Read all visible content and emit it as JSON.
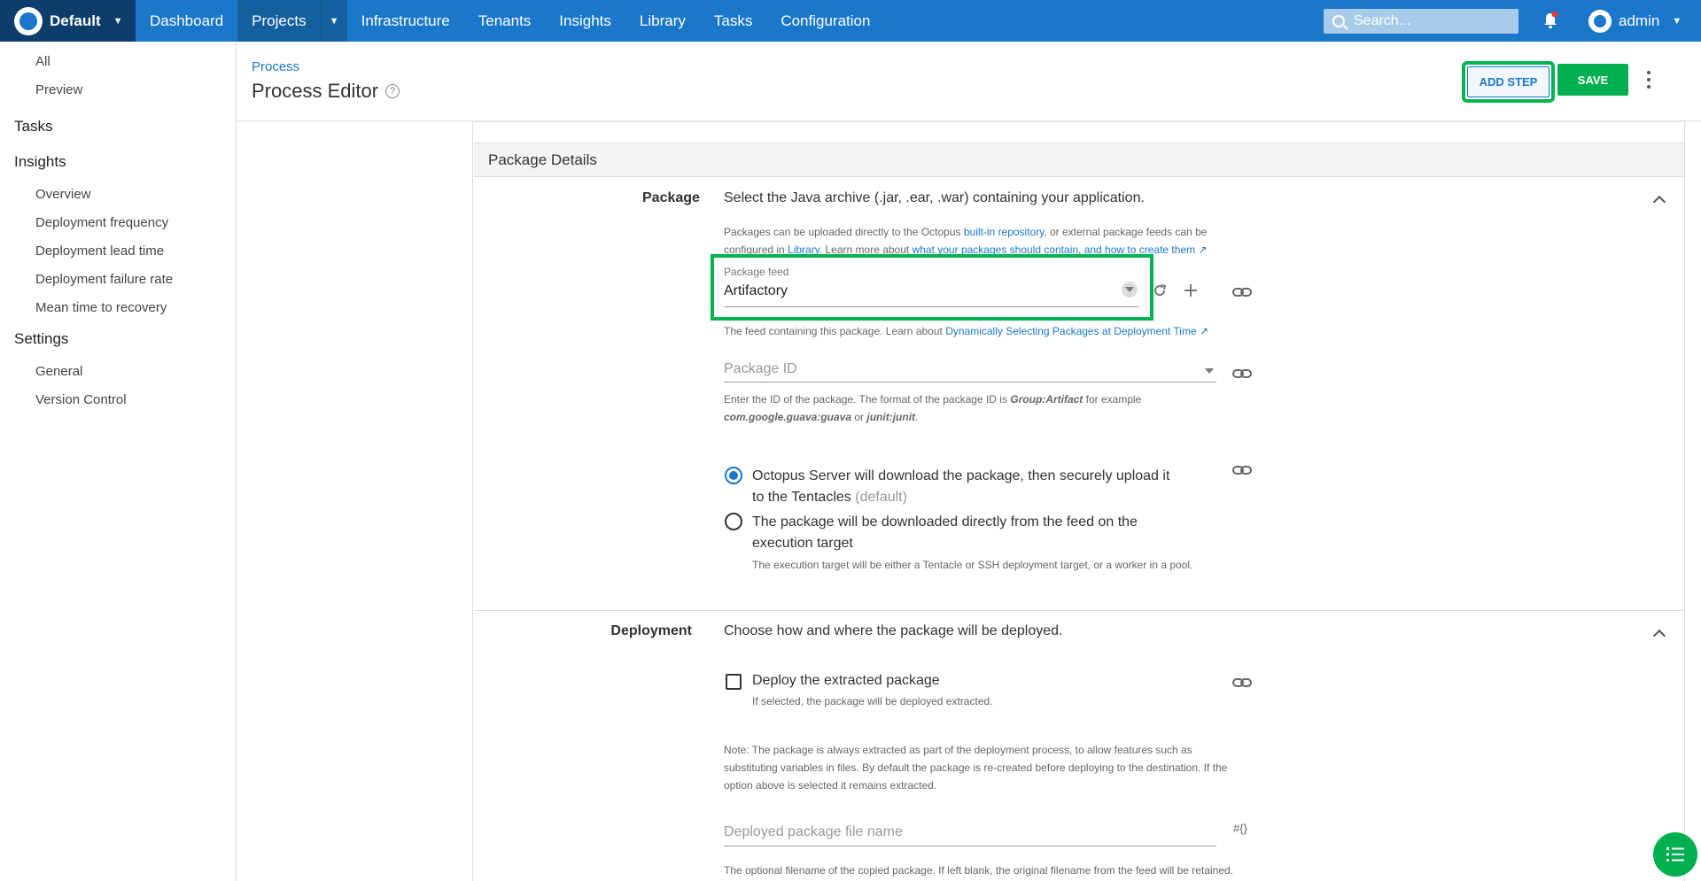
{
  "topnav": {
    "space_name": "Default",
    "items": [
      "Dashboard",
      "Projects",
      "Infrastructure",
      "Tenants",
      "Insights",
      "Library",
      "Tasks",
      "Configuration"
    ],
    "search_placeholder": "Search...",
    "user": "admin"
  },
  "sidebar": {
    "items_top": [
      "All",
      "Preview"
    ],
    "tasks": "Tasks",
    "insights": "Insights",
    "insights_items": [
      "Overview",
      "Deployment frequency",
      "Deployment lead time",
      "Deployment failure rate",
      "Mean time to recovery"
    ],
    "settings": "Settings",
    "settings_items": [
      "General",
      "Version Control"
    ]
  },
  "header": {
    "breadcrumb": "Process",
    "title": "Process Editor",
    "add_step": "ADD STEP",
    "save": "SAVE"
  },
  "section": {
    "title": "Package Details",
    "package_label": "Package",
    "package_desc": "Select the Java archive (.jar, .ear, .war) containing your application.",
    "pkg_help_1a": "Packages can be uploaded directly to the Octopus ",
    "pkg_help_1_link": "built-in repository",
    "pkg_help_1b": ", or external package feeds can be",
    "pkg_help_2a": "configured in ",
    "pkg_help_2_link1": "Library",
    "pkg_help_2b": ". Learn more about ",
    "pkg_help_2_link2": "what your packages should contain, and how to create them",
    "feed_label": "Package feed",
    "feed_value": "Artifactory",
    "feed_help_a": "The feed containing this package. Learn about ",
    "feed_help_link": "Dynamically Selecting Packages at Deployment Time",
    "package_id_placeholder": "Package ID",
    "pkgid_help_1a": "Enter the ID of the package. The format of the package ID is ",
    "pkgid_help_1b": "Group:Artifact",
    "pkgid_help_1c": " for example",
    "pkgid_help_2a": "com.google.guava:guava",
    "pkgid_help_2b": " or ",
    "pkgid_help_2c": "junit:junit",
    "pkgid_help_2d": ".",
    "radio1_line1": "Octopus Server will download the package, then securely upload it",
    "radio1_line2": "to the Tentacles",
    "radio1_default": "(default)",
    "radio2_line1": "The package will be downloaded directly from the feed on the",
    "radio2_line2": "execution target",
    "radio2_help": "The execution target will be either a Tentacle or SSH deployment target, or a worker in a pool.",
    "deployment_label": "Deployment",
    "deployment_desc": "Choose how and where the package will be deployed.",
    "checkbox_label": "Deploy the extracted package",
    "checkbox_help": "If selected, the package will be deployed extracted.",
    "note_1": "Note: The package is always extracted as part of the deployment process, to allow features such as",
    "note_2": "substituting variables in files. By default the package is re-created before deploying to the destination. If the",
    "note_3": "option above is selected it remains extracted.",
    "file_name_placeholder": "Deployed package file name",
    "file_name_help": "The optional filename of the copied package. If left blank, the original filename from the feed will be retained.",
    "var_icon_text": "#{}"
  },
  "colors": {
    "nav": "#1a77ca",
    "space": "#0d3d6b",
    "green": "#00b050",
    "highlight": "#00b450"
  }
}
